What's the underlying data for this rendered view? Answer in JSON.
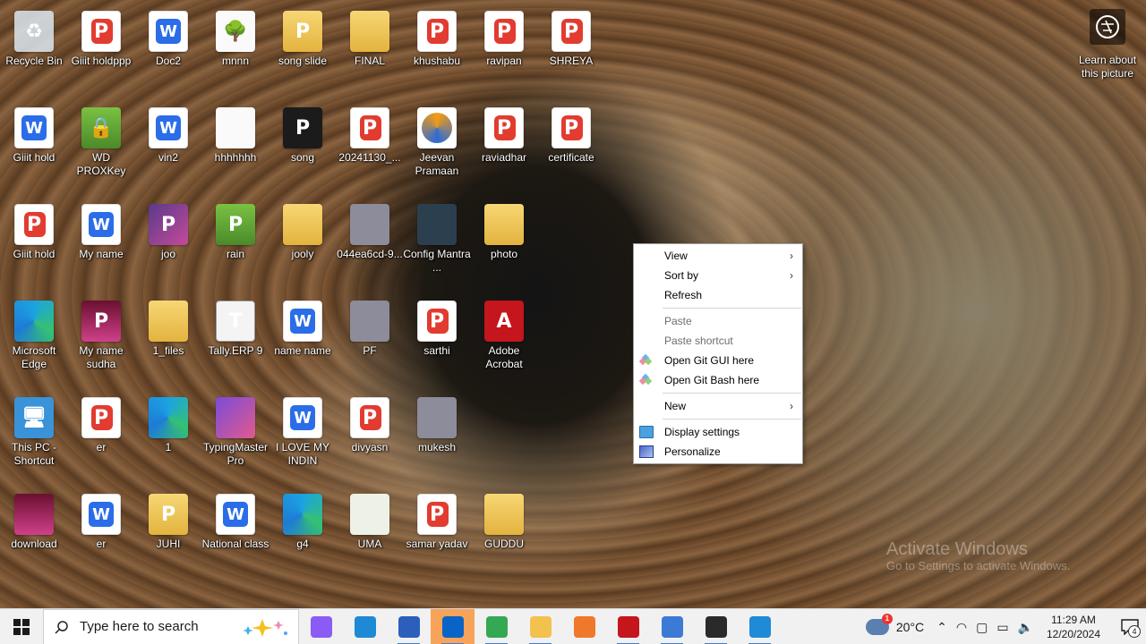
{
  "desktop": {
    "icons": [
      {
        "label": "Recycle Bin",
        "glyph": "♻"
      },
      {
        "label": "Giiit holdppp",
        "glyph": "P"
      },
      {
        "label": "Doc2",
        "glyph": "W"
      },
      {
        "label": "mnnn",
        "glyph": "🌳"
      },
      {
        "label": "song slide",
        "glyph": "P"
      },
      {
        "label": "FINAL",
        "glyph": ""
      },
      {
        "label": "khushabu",
        "glyph": "P"
      },
      {
        "label": "ravipan",
        "glyph": "P"
      },
      {
        "label": "SHREYA",
        "glyph": "P"
      },
      {
        "label": "Giiit hold",
        "glyph": "W"
      },
      {
        "label": "WD PROXKey",
        "glyph": "🔒"
      },
      {
        "label": "vin2",
        "glyph": "W"
      },
      {
        "label": "hhhhhhh",
        "glyph": ""
      },
      {
        "label": "song",
        "glyph": "P"
      },
      {
        "label": "20241130_...",
        "glyph": "P"
      },
      {
        "label": "Jeevan Pramaan",
        "glyph": ""
      },
      {
        "label": "raviadhar",
        "glyph": "P"
      },
      {
        "label": "certificate",
        "glyph": "P"
      },
      {
        "label": "Giiit hold",
        "glyph": "P"
      },
      {
        "label": "My name",
        "glyph": "W"
      },
      {
        "label": "joo",
        "glyph": "P"
      },
      {
        "label": "rain",
        "glyph": "P"
      },
      {
        "label": "jooly",
        "glyph": ""
      },
      {
        "label": "044ea6cd-9...",
        "glyph": ""
      },
      {
        "label": "Config Mantra ...",
        "glyph": ""
      },
      {
        "label": "photo",
        "glyph": ""
      },
      {
        "label": "Microsoft Edge",
        "glyph": ""
      },
      {
        "label": "My name sudha",
        "glyph": "P"
      },
      {
        "label": "1_files",
        "glyph": ""
      },
      {
        "label": "Tally.ERP 9",
        "glyph": "T"
      },
      {
        "label": "name name",
        "glyph": "W"
      },
      {
        "label": "PF",
        "glyph": ""
      },
      {
        "label": "sarthi",
        "glyph": "P"
      },
      {
        "label": "Adobe Acrobat",
        "glyph": "A"
      },
      {
        "label": "This PC - Shortcut",
        "glyph": "🖥"
      },
      {
        "label": "er",
        "glyph": "P"
      },
      {
        "label": "1",
        "glyph": ""
      },
      {
        "label": "TypingMaster Pro",
        "glyph": ""
      },
      {
        "label": "I LOVE MY INDIN",
        "glyph": "W"
      },
      {
        "label": "divyasn",
        "glyph": "P"
      },
      {
        "label": "mukesh",
        "glyph": ""
      },
      {
        "label": "download",
        "glyph": ""
      },
      {
        "label": "er",
        "glyph": "W"
      },
      {
        "label": "JUHI",
        "glyph": "P"
      },
      {
        "label": "National class",
        "glyph": "W"
      },
      {
        "label": "g4",
        "glyph": ""
      },
      {
        "label": "UMA",
        "glyph": ""
      },
      {
        "label": "samar yadav",
        "glyph": "P"
      },
      {
        "label": "GUDDU",
        "glyph": ""
      }
    ],
    "learn_label": "Learn about this picture",
    "watermark_title": "Activate Windows",
    "watermark_sub": "Go to Settings to activate Windows."
  },
  "context_menu": {
    "items": [
      {
        "label": "View",
        "submenu": true,
        "disabled": false
      },
      {
        "label": "Sort by",
        "submenu": true,
        "disabled": false
      },
      {
        "label": "Refresh",
        "submenu": false,
        "disabled": false
      },
      {
        "label": "Paste",
        "submenu": false,
        "disabled": true
      },
      {
        "label": "Paste shortcut",
        "submenu": false,
        "disabled": true
      },
      {
        "label": "Open Git GUI here",
        "submenu": false,
        "disabled": false,
        "icon": "git-icon"
      },
      {
        "label": "Open Git Bash here",
        "submenu": false,
        "disabled": false,
        "icon": "git-icon"
      },
      {
        "label": "New",
        "submenu": true,
        "disabled": false
      },
      {
        "label": "Display settings",
        "submenu": false,
        "disabled": false,
        "icon": "display-icon"
      },
      {
        "label": "Personalize",
        "submenu": false,
        "disabled": false,
        "icon": "personalize-icon"
      }
    ]
  },
  "taskbar": {
    "search_placeholder": "Type here to search",
    "apps": [
      {
        "name": "copilot-icon",
        "color": "#8a5cf5"
      },
      {
        "name": "edge-icon",
        "color": "#1e8ad6"
      },
      {
        "name": "word-icon",
        "color": "#2b5fbb"
      },
      {
        "name": "outlook-icon",
        "color": "#0a64c8",
        "active": true
      },
      {
        "name": "chrome-icon",
        "color": "#34a853"
      },
      {
        "name": "file-explorer-icon",
        "color": "#f2c14e"
      },
      {
        "name": "xampp-icon",
        "color": "#f0782a"
      },
      {
        "name": "acrobat-icon",
        "color": "#c4161c"
      },
      {
        "name": "calculator-icon",
        "color": "#3b7bd6"
      },
      {
        "name": "terminal-icon",
        "color": "#2a2a2a"
      },
      {
        "name": "vscode-icon",
        "color": "#1f8ad6"
      }
    ],
    "weather_temp": "20°C",
    "weather_badge": "1",
    "time": "11:29 AM",
    "date": "12/20/2024",
    "notification_count": "4"
  }
}
